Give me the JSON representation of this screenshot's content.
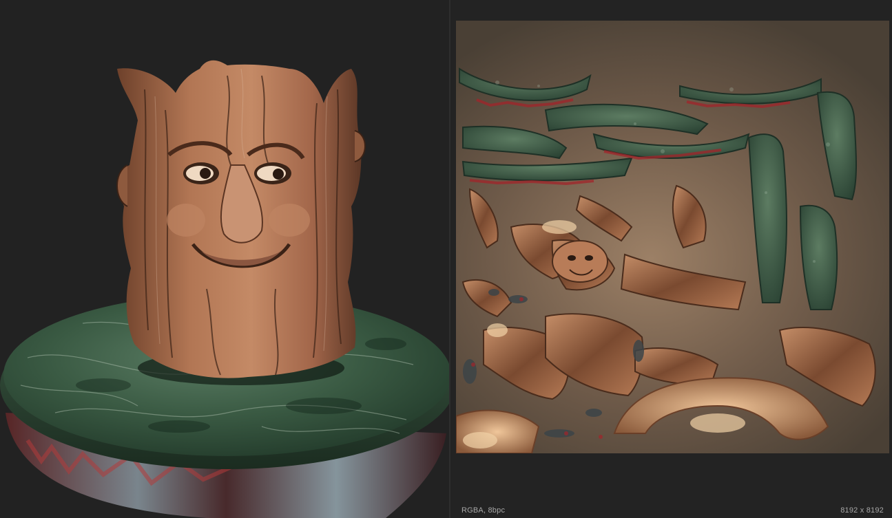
{
  "texture_panel": {
    "status_format": "RGBA, 8bpc",
    "status_size": "8192 x 8192"
  },
  "colors": {
    "background": "#232323",
    "wood": "#a86c4a",
    "marble": "#2f4a36",
    "status_text": "#a8a8a8"
  }
}
